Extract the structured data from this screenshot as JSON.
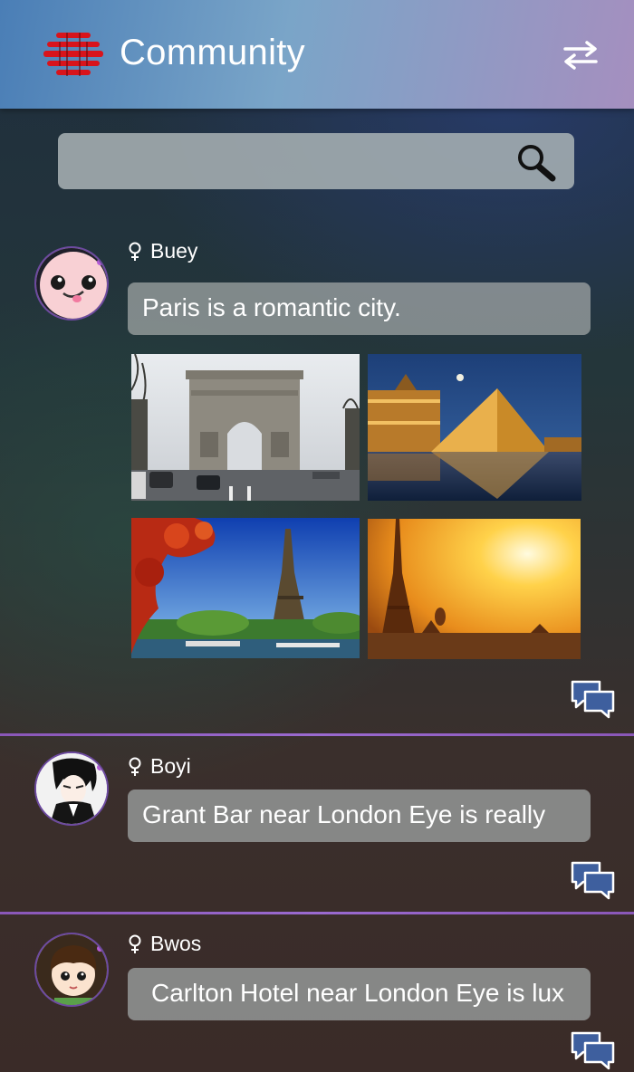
{
  "header": {
    "title": "Community",
    "logo_icon": "app-logo-icon",
    "switch_icon": "swap-arrows-icon"
  },
  "search": {
    "placeholder": "",
    "icon": "search-icon"
  },
  "posts": [
    {
      "username": "Buey",
      "gender_icon": "female-icon",
      "text": "Paris is a romantic city.",
      "photos": [
        "arc-de-triomphe-photo",
        "louvre-pyramid-photo",
        "eiffel-tower-day-photo",
        "eiffel-tower-sunset-photo"
      ]
    },
    {
      "username": "Boyi",
      "gender_icon": "female-icon",
      "text": "Grant Bar near London Eye is really"
    },
    {
      "username": "Bwos",
      "gender_icon": "female-icon",
      "text": "Carlton Hotel near London Eye is lux"
    }
  ],
  "colors": {
    "header_start": "#4a7eb6",
    "header_end": "#a58fbf",
    "divider": "#8a57b8",
    "logo_red": "#d8141c",
    "comment_blue": "#3e5f9e"
  }
}
